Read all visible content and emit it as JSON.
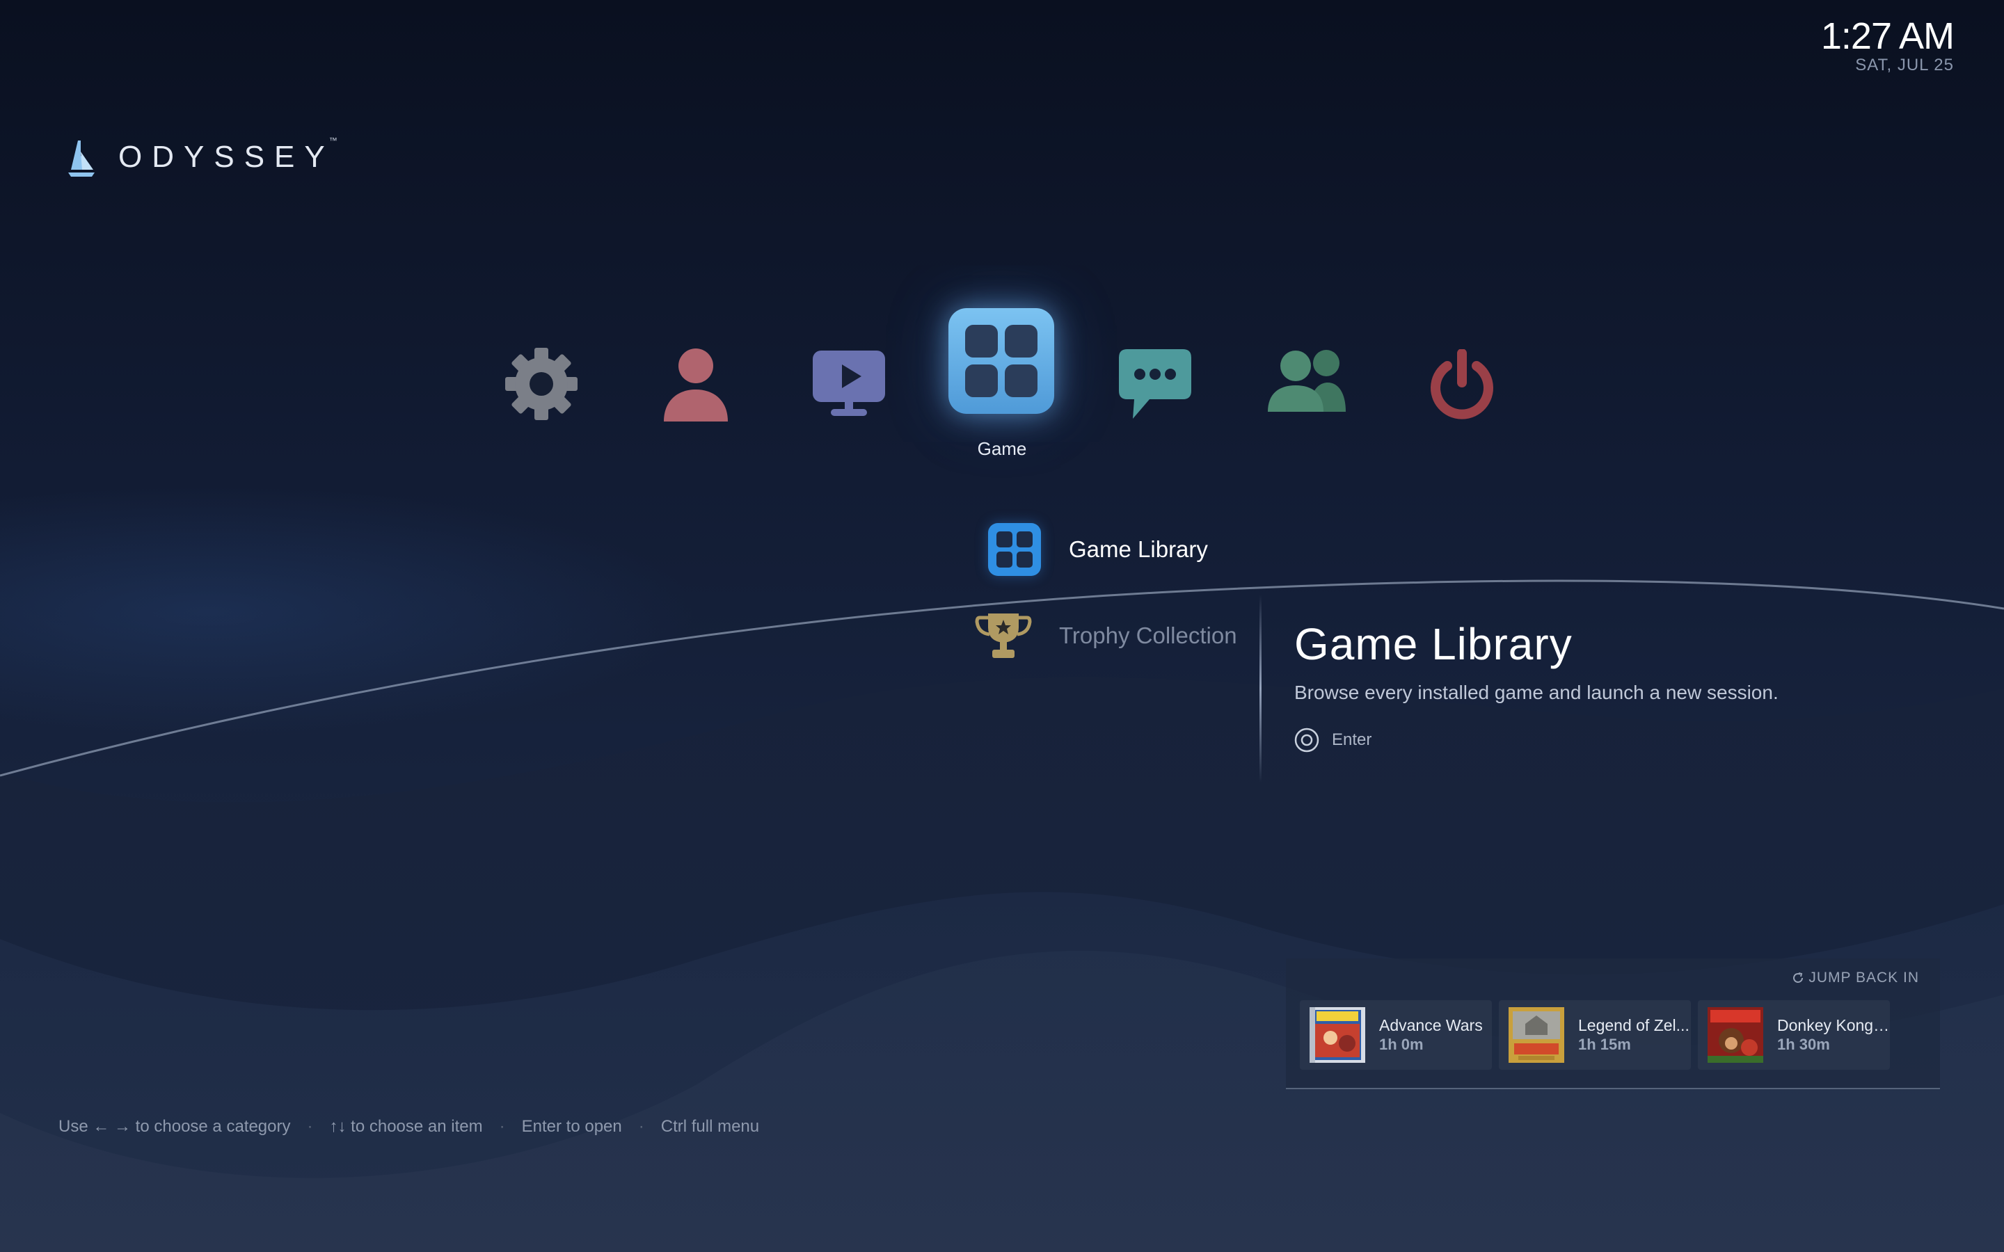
{
  "clock": {
    "time": "1:27 AM",
    "date": "SAT, JUL 25"
  },
  "brand": {
    "name": "ODYSSEY",
    "trademark": "™"
  },
  "categories": [
    {
      "id": "settings",
      "icon": "gear-icon",
      "color": "#7b7f88"
    },
    {
      "id": "profile",
      "icon": "user-icon",
      "color": "#b0646e"
    },
    {
      "id": "media",
      "icon": "play-monitor-icon",
      "color": "#6a72b0"
    },
    {
      "id": "game",
      "icon": "grid-icon",
      "label": "Game",
      "selected": true,
      "color": "#5aa7e6"
    },
    {
      "id": "messages",
      "icon": "chat-bubble-icon",
      "color": "#4e9a9c"
    },
    {
      "id": "friends",
      "icon": "people-icon",
      "color": "#4e8a72"
    },
    {
      "id": "power",
      "icon": "power-icon",
      "color": "#9a4048"
    }
  ],
  "sub_items": [
    {
      "id": "library",
      "label": "Game Library",
      "icon": "grid-icon",
      "selected": true
    },
    {
      "id": "trophies",
      "label": "Trophy Collection",
      "icon": "trophy-icon",
      "selected": false
    }
  ],
  "detail": {
    "title": "Game Library",
    "description": "Browse every installed game and launch a new session.",
    "action_label": "Enter"
  },
  "recent": {
    "header": "JUMP BACK IN",
    "games": [
      {
        "title": "Advance Wars",
        "time": "1h 0m"
      },
      {
        "title": "Legend of Zel...",
        "time": "1h 15m"
      },
      {
        "title": "Donkey Kong ...",
        "time": "1h 30m"
      }
    ]
  },
  "hints": {
    "category": "Use ← → to choose a category",
    "item": "↑↓ to choose an item",
    "open": "Enter to open",
    "menu": "Ctrl full menu",
    "separator": "·"
  },
  "colors": {
    "accent": "#2f8fe3",
    "trophy": "#b09a62"
  }
}
